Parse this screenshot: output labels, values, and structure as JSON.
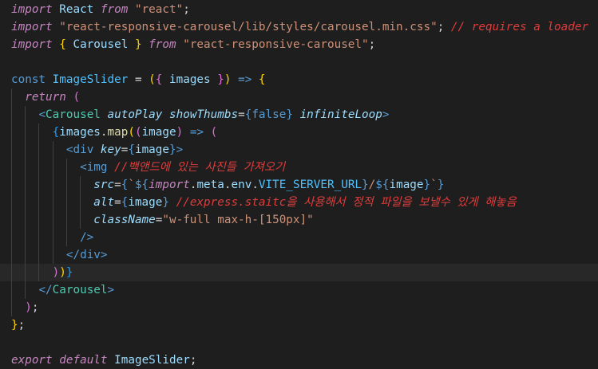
{
  "colors": {
    "background": "#1e1e1e",
    "active_line": "#282828",
    "keyword": "#569cd6",
    "control": "#c586c0",
    "string": "#ce9178",
    "plain": "#d4d4d4",
    "variable": "#9cdcfe",
    "function": "#dcdcaa",
    "component": "#4ec9b0",
    "tag": "#569cd6",
    "comment": "#e03c3c",
    "bracket_yellow": "#ffd700",
    "bracket_pink": "#da70d6",
    "bracket_blue": "#179fff",
    "constant": "#4fc1ff"
  },
  "editor": {
    "active_line": 15,
    "lines": [
      [
        {
          "t": "import",
          "c": "control",
          "i": true
        },
        {
          "t": " React ",
          "c": "variable"
        },
        {
          "t": "from",
          "c": "control",
          "i": true
        },
        {
          "t": " ",
          "c": "plain"
        },
        {
          "t": "\"react\"",
          "c": "string"
        },
        {
          "t": ";",
          "c": "plain"
        }
      ],
      [
        {
          "t": "import",
          "c": "control",
          "i": true
        },
        {
          "t": " ",
          "c": "plain"
        },
        {
          "t": "\"react-responsive-carousel/lib/styles/carousel.min.css\"",
          "c": "string"
        },
        {
          "t": "; ",
          "c": "plain"
        },
        {
          "t": "// requires a loader",
          "c": "comment",
          "i": true
        }
      ],
      [
        {
          "t": "import",
          "c": "control",
          "i": true
        },
        {
          "t": " ",
          "c": "plain"
        },
        {
          "t": "{",
          "c": "bracket_yellow"
        },
        {
          "t": " Carousel ",
          "c": "variable"
        },
        {
          "t": "}",
          "c": "bracket_yellow"
        },
        {
          "t": " ",
          "c": "plain"
        },
        {
          "t": "from",
          "c": "control",
          "i": true
        },
        {
          "t": " ",
          "c": "plain"
        },
        {
          "t": "\"react-responsive-carousel\"",
          "c": "string"
        },
        {
          "t": ";",
          "c": "plain"
        }
      ],
      [],
      [
        {
          "t": "const",
          "c": "keyword"
        },
        {
          "t": " ImageSlider ",
          "c": "constant"
        },
        {
          "t": "=",
          "c": "plain"
        },
        {
          "t": " ",
          "c": "plain"
        },
        {
          "t": "(",
          "c": "bracket_yellow"
        },
        {
          "t": "{",
          "c": "bracket_pink"
        },
        {
          "t": " images ",
          "c": "variable"
        },
        {
          "t": "}",
          "c": "bracket_pink"
        },
        {
          "t": ")",
          "c": "bracket_yellow"
        },
        {
          "t": " ",
          "c": "plain"
        },
        {
          "t": "=>",
          "c": "keyword"
        },
        {
          "t": " ",
          "c": "plain"
        },
        {
          "t": "{",
          "c": "bracket_yellow"
        }
      ],
      [
        {
          "t": "  ",
          "c": "plain"
        },
        {
          "t": "return",
          "c": "control",
          "i": true
        },
        {
          "t": " ",
          "c": "plain"
        },
        {
          "t": "(",
          "c": "bracket_pink"
        }
      ],
      [
        {
          "t": "    ",
          "c": "plain"
        },
        {
          "t": "<",
          "c": "tag"
        },
        {
          "t": "Carousel",
          "c": "component"
        },
        {
          "t": " ",
          "c": "plain"
        },
        {
          "t": "autoPlay",
          "c": "variable",
          "i": true
        },
        {
          "t": " ",
          "c": "plain"
        },
        {
          "t": "showThumbs",
          "c": "variable",
          "i": true
        },
        {
          "t": "=",
          "c": "plain"
        },
        {
          "t": "{",
          "c": "keyword"
        },
        {
          "t": "false",
          "c": "keyword"
        },
        {
          "t": "}",
          "c": "keyword"
        },
        {
          "t": " ",
          "c": "plain"
        },
        {
          "t": "infiniteLoop",
          "c": "variable",
          "i": true
        },
        {
          "t": ">",
          "c": "tag"
        }
      ],
      [
        {
          "t": "      ",
          "c": "plain"
        },
        {
          "t": "{",
          "c": "bracket_blue"
        },
        {
          "t": "images",
          "c": "variable"
        },
        {
          "t": ".",
          "c": "plain"
        },
        {
          "t": "map",
          "c": "function"
        },
        {
          "t": "(",
          "c": "bracket_yellow"
        },
        {
          "t": "(",
          "c": "bracket_pink"
        },
        {
          "t": "image",
          "c": "variable"
        },
        {
          "t": ")",
          "c": "bracket_pink"
        },
        {
          "t": " ",
          "c": "plain"
        },
        {
          "t": "=>",
          "c": "keyword"
        },
        {
          "t": " ",
          "c": "plain"
        },
        {
          "t": "(",
          "c": "bracket_pink"
        }
      ],
      [
        {
          "t": "        ",
          "c": "plain"
        },
        {
          "t": "<",
          "c": "tag"
        },
        {
          "t": "div",
          "c": "tag"
        },
        {
          "t": " ",
          "c": "plain"
        },
        {
          "t": "key",
          "c": "variable",
          "i": true
        },
        {
          "t": "=",
          "c": "plain"
        },
        {
          "t": "{",
          "c": "keyword"
        },
        {
          "t": "image",
          "c": "variable"
        },
        {
          "t": "}",
          "c": "keyword"
        },
        {
          "t": ">",
          "c": "tag"
        }
      ],
      [
        {
          "t": "          ",
          "c": "plain"
        },
        {
          "t": "<",
          "c": "tag"
        },
        {
          "t": "img",
          "c": "tag"
        },
        {
          "t": " ",
          "c": "plain"
        },
        {
          "t": "//백앤드에 있는 사진들 가져오기",
          "c": "comment",
          "i": true
        }
      ],
      [
        {
          "t": "            ",
          "c": "plain"
        },
        {
          "t": "src",
          "c": "variable",
          "i": true
        },
        {
          "t": "=",
          "c": "plain"
        },
        {
          "t": "{",
          "c": "keyword"
        },
        {
          "t": "`",
          "c": "string"
        },
        {
          "t": "${",
          "c": "keyword"
        },
        {
          "t": "import",
          "c": "control",
          "i": true
        },
        {
          "t": ".",
          "c": "plain"
        },
        {
          "t": "meta",
          "c": "variable"
        },
        {
          "t": ".",
          "c": "plain"
        },
        {
          "t": "env",
          "c": "variable"
        },
        {
          "t": ".",
          "c": "plain"
        },
        {
          "t": "VITE_SERVER_URL",
          "c": "constant"
        },
        {
          "t": "}",
          "c": "keyword"
        },
        {
          "t": "/",
          "c": "string"
        },
        {
          "t": "${",
          "c": "keyword"
        },
        {
          "t": "image",
          "c": "variable"
        },
        {
          "t": "}",
          "c": "keyword"
        },
        {
          "t": "`",
          "c": "string"
        },
        {
          "t": "}",
          "c": "keyword"
        }
      ],
      [
        {
          "t": "            ",
          "c": "plain"
        },
        {
          "t": "alt",
          "c": "variable",
          "i": true
        },
        {
          "t": "=",
          "c": "plain"
        },
        {
          "t": "{",
          "c": "keyword"
        },
        {
          "t": "image",
          "c": "variable"
        },
        {
          "t": "}",
          "c": "keyword"
        },
        {
          "t": " ",
          "c": "plain"
        },
        {
          "t": "//express.staitc을 사용해서 정적 파일을 보낼수 있게 해놓음",
          "c": "comment",
          "i": true
        }
      ],
      [
        {
          "t": "            ",
          "c": "plain"
        },
        {
          "t": "className",
          "c": "variable",
          "i": true
        },
        {
          "t": "=",
          "c": "plain"
        },
        {
          "t": "\"w-full max-h-[150px]\"",
          "c": "string"
        }
      ],
      [
        {
          "t": "          ",
          "c": "plain"
        },
        {
          "t": "/>",
          "c": "tag"
        }
      ],
      [
        {
          "t": "        ",
          "c": "plain"
        },
        {
          "t": "</",
          "c": "tag"
        },
        {
          "t": "div",
          "c": "tag"
        },
        {
          "t": ">",
          "c": "tag"
        }
      ],
      [
        {
          "t": "      ",
          "c": "plain"
        },
        {
          "t": ")",
          "c": "bracket_pink"
        },
        {
          "t": ")",
          "c": "bracket_yellow"
        },
        {
          "t": "}",
          "c": "bracket_blue"
        }
      ],
      [
        {
          "t": "    ",
          "c": "plain"
        },
        {
          "t": "</",
          "c": "tag"
        },
        {
          "t": "Carousel",
          "c": "component"
        },
        {
          "t": ">",
          "c": "tag"
        }
      ],
      [
        {
          "t": "  ",
          "c": "plain"
        },
        {
          "t": ")",
          "c": "bracket_pink"
        },
        {
          "t": ";",
          "c": "plain"
        }
      ],
      [
        {
          "t": "}",
          "c": "bracket_yellow"
        },
        {
          "t": ";",
          "c": "plain"
        }
      ],
      [],
      [
        {
          "t": "export",
          "c": "control",
          "i": true
        },
        {
          "t": " ",
          "c": "plain"
        },
        {
          "t": "default",
          "c": "control",
          "i": true
        },
        {
          "t": " ImageSlider",
          "c": "variable"
        },
        {
          "t": ";",
          "c": "plain"
        }
      ]
    ]
  }
}
